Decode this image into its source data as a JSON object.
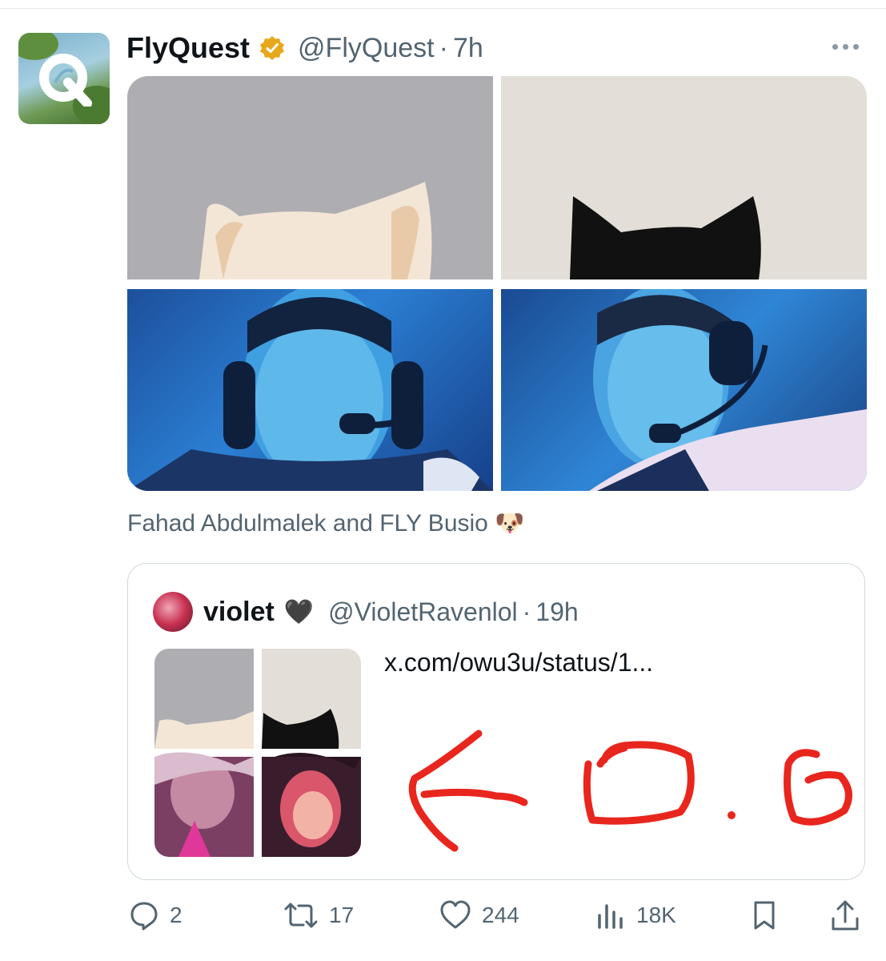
{
  "post": {
    "display_name": "FlyQuest",
    "handle": "@FlyQuest",
    "separator": "·",
    "time": "7h",
    "caption": "Fahad Abdulmalek and FLY Busio 🐶"
  },
  "quote": {
    "display_name": "violet",
    "emoji": "🖤",
    "handle": "@VioletRavenlol",
    "separator": "·",
    "time": "19h",
    "link_text": "x.com/owu3u/status/1..."
  },
  "actions": {
    "replies": "2",
    "reposts": "17",
    "likes": "244",
    "views": "18K"
  },
  "colors": {
    "verified": "#e8a81c",
    "drawing": "#e8261e",
    "muted_text": "#536471"
  },
  "icons": [
    "more-icon",
    "verified-badge-icon",
    "reply-icon",
    "repost-icon",
    "like-icon",
    "views-icon",
    "bookmark-icon",
    "share-icon"
  ]
}
